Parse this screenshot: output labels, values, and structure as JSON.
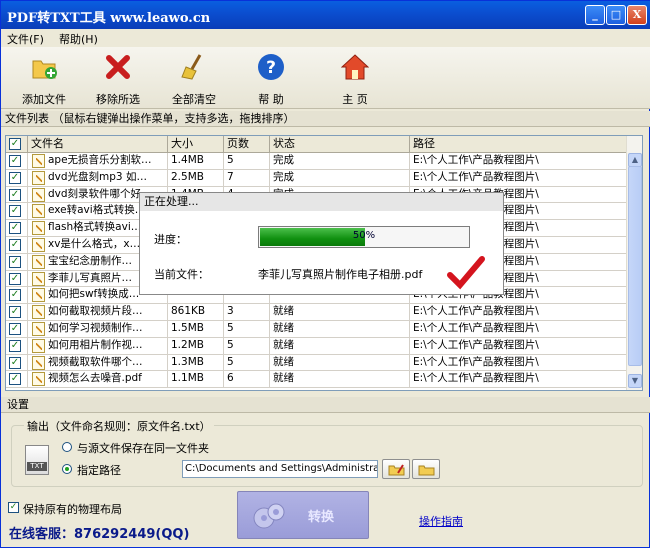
{
  "window": {
    "title": "PDF转TXT工具 www.leawo.cn",
    "controls": {
      "minimize": "_",
      "maximize": "□",
      "close": "X"
    }
  },
  "menu": {
    "file": "文件(F)",
    "help": "帮助(H)"
  },
  "toolbar": {
    "items": [
      {
        "label": "添加文件",
        "icon": "add-file-icon"
      },
      {
        "label": "移除所选",
        "icon": "remove-x-icon"
      },
      {
        "label": "全部清空",
        "icon": "broom-icon"
      },
      {
        "label": "帮 助",
        "icon": "help-icon"
      },
      {
        "label": "主 页",
        "icon": "home-icon"
      }
    ]
  },
  "file_list": {
    "header": "文件列表 （鼠标右键弹出操作菜单，支持多选，拖拽排序）",
    "columns": [
      "文件名",
      "大小",
      "页数",
      "状态",
      "路径"
    ],
    "rows": [
      {
        "checked": true,
        "name": "ape无损音乐分割软…",
        "size": "1.4MB",
        "pages": "5",
        "status": "完成",
        "path": "E:\\个人工作\\产品教程图片\\"
      },
      {
        "checked": true,
        "name": "dvd光盘刻mp3 如…",
        "size": "2.5MB",
        "pages": "7",
        "status": "完成",
        "path": "E:\\个人工作\\产品教程图片\\"
      },
      {
        "checked": true,
        "name": "dvd刻录软件哪个好…",
        "size": "1.4MB",
        "pages": "4",
        "status": "完成",
        "path": "E:\\个人工作\\产品教程图片\\"
      },
      {
        "checked": true,
        "name": "exe转avi格式转换…",
        "size": "",
        "pages": "",
        "status": "",
        "path": "E:\\个人工作\\产品教程图片\\"
      },
      {
        "checked": true,
        "name": "flash格式转换avi…",
        "size": "",
        "pages": "",
        "status": "",
        "path": "E:\\个人工作\\产品教程图片\\"
      },
      {
        "checked": true,
        "name": "xv是什么格式，x…",
        "size": "",
        "pages": "",
        "status": "",
        "path": "E:\\个人工作\\产品教程图片\\"
      },
      {
        "checked": true,
        "name": "宝宝纪念册制作…",
        "size": "",
        "pages": "",
        "status": "",
        "path": "E:\\个人工作\\产品教程图片\\"
      },
      {
        "checked": true,
        "name": "李菲儿写真照片…",
        "size": "",
        "pages": "",
        "status": "",
        "path": "E:\\个人工作\\产品教程图片\\"
      },
      {
        "checked": true,
        "name": "如何把swf转换成…",
        "size": "",
        "pages": "",
        "status": "",
        "path": "E:\\个人工作\\产品教程图片\\"
      },
      {
        "checked": true,
        "name": "如何截取视频片段…",
        "size": "861KB",
        "pages": "3",
        "status": "就绪",
        "path": "E:\\个人工作\\产品教程图片\\"
      },
      {
        "checked": true,
        "name": "如何学习视频制作…",
        "size": "1.5MB",
        "pages": "5",
        "status": "就绪",
        "path": "E:\\个人工作\\产品教程图片\\"
      },
      {
        "checked": true,
        "name": "如何用相片制作视…",
        "size": "1.2MB",
        "pages": "5",
        "status": "就绪",
        "path": "E:\\个人工作\\产品教程图片\\"
      },
      {
        "checked": true,
        "name": "视频截取软件哪个…",
        "size": "1.3MB",
        "pages": "5",
        "status": "就绪",
        "path": "E:\\个人工作\\产品教程图片\\"
      },
      {
        "checked": true,
        "name": "视频怎么去噪音.pdf",
        "size": "1.1MB",
        "pages": "6",
        "status": "就绪",
        "path": "E:\\个人工作\\产品教程图片\\"
      }
    ]
  },
  "progress_dialog": {
    "title": "正在处理...",
    "progress_label": "进度：",
    "progress_value": 0.5,
    "progress_text": "50%",
    "current_label": "当前文件：",
    "current_file": "李菲儿写真照片制作电子相册.pdf"
  },
  "settings": {
    "title": "设置",
    "output_legend": "输出（文件命名规则：原文件名.txt）",
    "txt_icon_label": "TXT",
    "opt_same": "与源文件保存在同一文件夹",
    "opt_path": "指定路径",
    "path_value": "C:\\Documents and Settings\\Administrator\\桌面",
    "keep_layout": "保持原有的物理布局",
    "service": "在线客服：876292449(QQ)",
    "convert": "转换",
    "guide": "操作指南"
  },
  "colors": {
    "title_bar": "#0b4fd1",
    "progress": "#109010",
    "service_text": "#0a1a8a",
    "link": "#0000c8"
  }
}
